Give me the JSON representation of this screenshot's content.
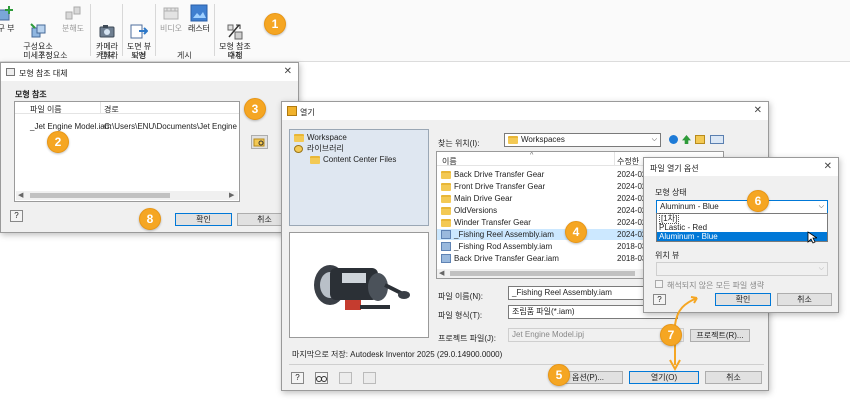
{
  "ribbon": {
    "buttons": [
      {
        "label": "구 부",
        "disabled": false
      },
      {
        "label": "구성요소\n미세조정",
        "disabled": false
      },
      {
        "label": "분해도",
        "disabled": true
      },
      {
        "label": "카메라\n캡처",
        "disabled": false
      },
      {
        "label": "도면 뷰\n작성",
        "disabled": false
      },
      {
        "label": "비디오",
        "disabled": true
      },
      {
        "label": "래스터",
        "disabled": false
      },
      {
        "label": "모형 참조\n대체",
        "disabled": false
      }
    ],
    "groups": [
      "구성요소",
      "카메라",
      "도면",
      "게시",
      "수정"
    ]
  },
  "replace_dialog": {
    "title": "모형 참조 대체",
    "section": "모형 참조",
    "col_file": "파일 이름",
    "col_path": "경로",
    "row_file": "_Jet Engine Model.iam",
    "row_path": "C:\\Users\\ENU\\Documents\\Jet Engine",
    "ok": "확인",
    "cancel": "취소"
  },
  "open_dialog": {
    "title": "열기",
    "tree": [
      "Workspace",
      "라이브러리",
      "Content Center Files"
    ],
    "look_in_label": "찾는 위치(I):",
    "look_in_value": "Workspaces",
    "col_name": "이름",
    "col_modified": "수정한 ",
    "files": [
      {
        "name": "Back Drive Transfer Gear",
        "date": "2024-02-",
        "type": "folder"
      },
      {
        "name": "Front Drive Transfer Gear",
        "date": "2024-02-",
        "type": "folder"
      },
      {
        "name": "Main Drive Gear",
        "date": "2024-02-",
        "type": "folder"
      },
      {
        "name": "OldVersions",
        "date": "2024-02-",
        "type": "folder"
      },
      {
        "name": "Winder Transfer Gear",
        "date": "2024-02-",
        "type": "folder"
      },
      {
        "name": "_Fishing Reel Assembly.iam",
        "date": "2024-02-",
        "type": "asm"
      },
      {
        "name": "_Fishing Rod Assembly.iam",
        "date": "2018-03-",
        "type": "asm"
      },
      {
        "name": "Back Drive Transfer Gear.iam",
        "date": "2018-03-",
        "type": "asm"
      }
    ],
    "filename_label": "파일 이름(N):",
    "filename_value": "_Fishing Reel Assembly.iam",
    "filetype_label": "파일 형식(T):",
    "filetype_value": "조립품 파일(*.iam)",
    "project_label": "프로젝트 파일(J):",
    "project_value": "Jet Engine Model.ipj",
    "project_button": "프로젝트(R)...",
    "last_saved": "마지막으로 저장: Autodesk Inventor 2025 (29.0.14900.0000)",
    "options_button": "옵션(P)...",
    "open_button": "열기(O)",
    "cancel_button": "취소"
  },
  "options_dialog": {
    "title": "파일 열기 옵션",
    "model_state_label": "모형 상태",
    "selected": "Aluminum - Blue",
    "options": [
      "[1차]",
      "PLastic - Red",
      "Aluminum - Blue"
    ],
    "position_view_label": "위치 뷰",
    "defer_label": "해석되지 않은 모든 파일 생략",
    "ok": "확인",
    "cancel": "취소"
  },
  "callouts": [
    "1",
    "2",
    "3",
    "4",
    "5",
    "6",
    "7",
    "8"
  ],
  "colors": {
    "accent": "#0078d7",
    "badge": "#f5a623",
    "selection": "#cce8ff"
  }
}
